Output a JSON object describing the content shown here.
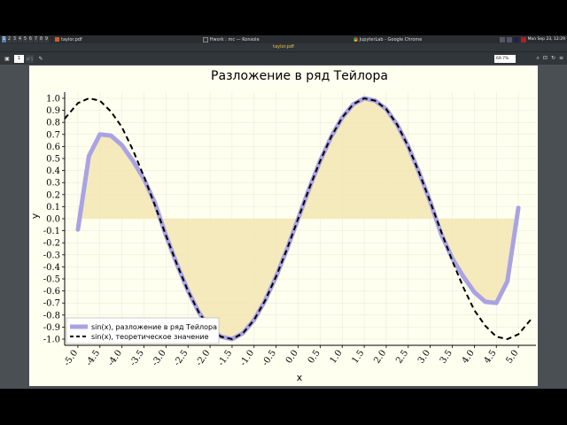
{
  "taskbar": {
    "workspaces": [
      "1",
      "2",
      "3",
      "4",
      "5",
      "6",
      "7",
      "8",
      "9"
    ],
    "tasks": [
      {
        "label": "taylor.pdf"
      },
      {
        "label": "Hwork : mc — Konsole"
      },
      {
        "label": "JupyterLab - Google Chrome"
      }
    ],
    "clock": "Mon Sep 23, 12:29"
  },
  "window": {
    "title": "taylor.pdf"
  },
  "toolbar": {
    "page_number": "1",
    "page_of": "of 1",
    "zoom": "69.7%"
  },
  "chart_data": {
    "type": "line",
    "title": "Разложение в ряд Тейлора",
    "xlabel": "x",
    "ylabel": "y",
    "xlim": [
      -5.3,
      5.4
    ],
    "ylim": [
      -1.0,
      1.0
    ],
    "xticks": [
      "-5.0",
      "-4.5",
      "-4.0",
      "-3.5",
      "-3.0",
      "-2.5",
      "-2.0",
      "-1.5",
      "-1.0",
      "-0.5",
      "0.0",
      "0.5",
      "1.0",
      "1.5",
      "2.0",
      "2.5",
      "3.0",
      "3.5",
      "4.0",
      "4.5",
      "5.0"
    ],
    "yticks": [
      "1.0",
      "0.9",
      "0.8",
      "0.7",
      "0.6",
      "0.5",
      "0.4",
      "0.3",
      "0.2",
      "0.1",
      "0.0",
      "-0.1",
      "-0.2",
      "-0.3",
      "-0.4",
      "-0.5",
      "-0.6",
      "-0.7",
      "-0.8",
      "-0.9",
      "-1.0"
    ],
    "grid": true,
    "legend_position": "lower-left",
    "series": [
      {
        "name": "sin(x), разложение в ряд Тейлора",
        "style": "thick-solid",
        "color": "#a9a3e3",
        "fill": "#f3e6b3",
        "x": [
          -5.0,
          -4.75,
          -4.5,
          -4.25,
          -4.0,
          -3.75,
          -3.5,
          -3.25,
          -3.0,
          -2.75,
          -2.5,
          -2.25,
          -2.0,
          -1.75,
          -1.5,
          -1.25,
          -1.0,
          -0.75,
          -0.5,
          -0.25,
          0.0,
          0.25,
          0.5,
          0.75,
          1.0,
          1.25,
          1.5,
          1.75,
          2.0,
          2.25,
          2.5,
          2.75,
          3.0,
          3.25,
          3.5,
          3.75,
          4.0,
          4.25,
          4.5,
          4.75,
          5.0
        ],
        "y": [
          -0.09,
          0.52,
          0.7,
          0.69,
          0.61,
          0.48,
          0.33,
          0.13,
          -0.14,
          -0.38,
          -0.6,
          -0.78,
          -0.91,
          -0.98,
          -1.0,
          -0.95,
          -0.84,
          -0.68,
          -0.48,
          -0.25,
          0.0,
          0.25,
          0.48,
          0.68,
          0.84,
          0.95,
          1.0,
          0.98,
          0.91,
          0.78,
          0.6,
          0.38,
          0.14,
          -0.13,
          -0.33,
          -0.48,
          -0.61,
          -0.69,
          -0.7,
          -0.52,
          0.09
        ]
      },
      {
        "name": "sin(x), теоретическое значение",
        "style": "dashed",
        "color": "#000000",
        "x": [
          -5.3,
          -5.0,
          -4.75,
          -4.5,
          -4.25,
          -4.0,
          -3.75,
          -3.5,
          -3.25,
          -3.0,
          -2.75,
          -2.5,
          -2.25,
          -2.0,
          -1.75,
          -1.5,
          -1.25,
          -1.0,
          -0.75,
          -0.5,
          -0.25,
          0.0,
          0.25,
          0.5,
          0.75,
          1.0,
          1.25,
          1.5,
          1.75,
          2.0,
          2.25,
          2.5,
          2.75,
          3.0,
          3.25,
          3.5,
          3.75,
          4.0,
          4.25,
          4.5,
          4.75,
          5.0,
          5.3
        ],
        "y": [
          0.83,
          0.96,
          1.0,
          0.98,
          0.89,
          0.76,
          0.57,
          0.35,
          0.11,
          -0.14,
          -0.38,
          -0.6,
          -0.78,
          -0.91,
          -0.98,
          -1.0,
          -0.95,
          -0.84,
          -0.68,
          -0.48,
          -0.25,
          0.0,
          0.25,
          0.48,
          0.68,
          0.84,
          0.95,
          1.0,
          0.98,
          0.91,
          0.78,
          0.6,
          0.38,
          0.14,
          -0.11,
          -0.35,
          -0.57,
          -0.76,
          -0.89,
          -0.98,
          -1.0,
          -0.96,
          -0.83
        ]
      }
    ]
  }
}
